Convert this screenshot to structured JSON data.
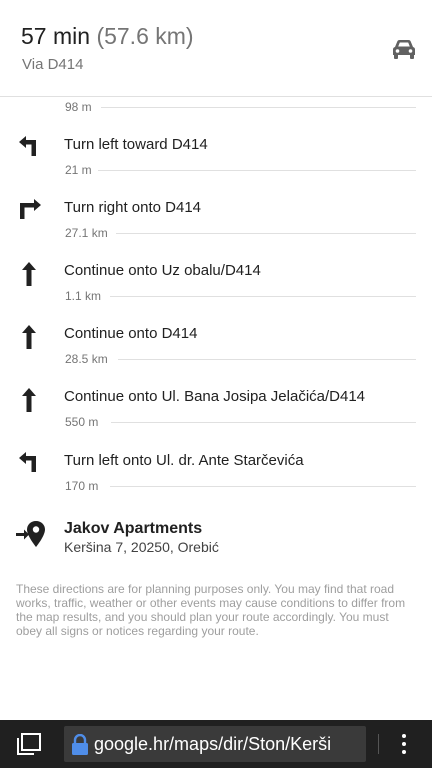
{
  "route": {
    "duration": "57 min",
    "distance": "(57.6 km)",
    "via": "Via D414",
    "mode_icon": "car-icon"
  },
  "first_segment_distance": "98 m",
  "steps": [
    {
      "icon": "turn-left-icon",
      "instruction": "Turn left toward D414",
      "distance": "21 m"
    },
    {
      "icon": "turn-right-icon",
      "instruction": "Turn right onto D414",
      "distance": "27.1 km"
    },
    {
      "icon": "straight-arrow-icon",
      "instruction": "Continue onto Uz obalu/D414",
      "distance": "1.1 km"
    },
    {
      "icon": "straight-arrow-icon",
      "instruction": "Continue onto D414",
      "distance": "28.5 km"
    },
    {
      "icon": "straight-arrow-icon",
      "instruction": "Continue onto Ul. Bana Josipa Jelačića/D414",
      "distance": "550 m"
    },
    {
      "icon": "turn-left-icon",
      "instruction": "Turn left onto Ul. dr. Ante Starčevića",
      "distance": "170 m"
    }
  ],
  "destination": {
    "name": "Jakov Apartments",
    "address": "Keršina 7, 20250, Orebić",
    "icon": "destination-pin-icon"
  },
  "disclaimer": "These directions are for planning purposes only. You may find that road works, traffic, weather or other events may cause conditions to differ from the map results, and you should plan your route accordingly. You must obey all signs or notices regarding your route.",
  "browser": {
    "url": "google.hr/maps/dir/Ston/Kerši",
    "secure_icon": "lock-icon",
    "tabs_icon": "tabs-icon",
    "menu_icon": "overflow-menu-icon"
  },
  "colors": {
    "text_primary": "#212121",
    "text_secondary": "#757575",
    "browser_bar": "#202020"
  }
}
